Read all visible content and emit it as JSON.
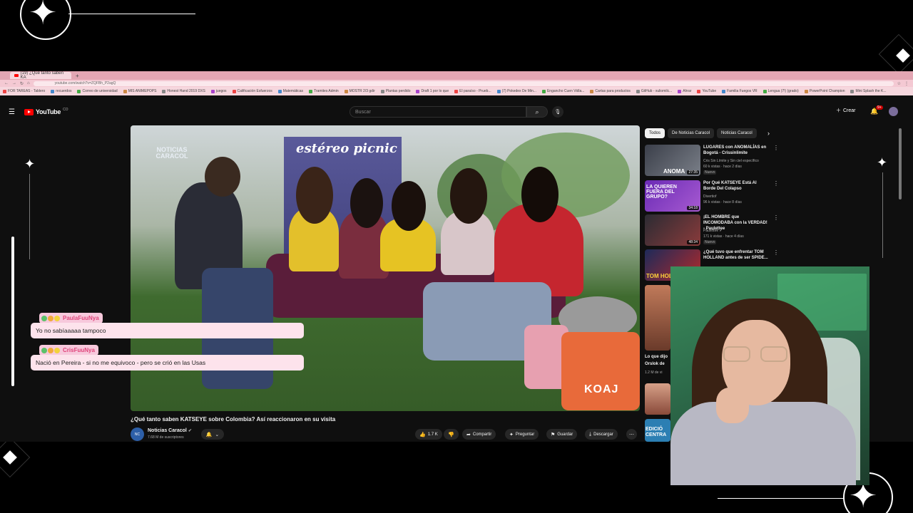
{
  "browser": {
    "tab_title": "(19) ¿Qué tanto saben KA",
    "url": "youtube.com/watch?v=ZQFBh_P2agQ",
    "bookmarks": [
      "FOR TAREAS - Tablero",
      "recuerdos",
      "Correo de universidad",
      "MIS ANIMEPOPS",
      "Honest Hand 2019 DXS",
      "juegos",
      "Calificación Esfuerzos",
      "Matemáticas",
      "Tramites Admin",
      "MOSTR 2/3 gdir",
      "Plantas perdido",
      "Draft 1 por lo que",
      "El paraíso - Prueb...",
      "(7) Pokedex De Min...",
      "Engancho Cuen Vidla...",
      "Cartas para productos",
      "GitHub - xuliomilc...",
      "Ahrar",
      "YouTube",
      "Familia Fuegos VR",
      "Lengua (7!) (grado)",
      "PowerPoint Champion",
      "Mini Splash the K..."
    ]
  },
  "youtube": {
    "logo_text": "YouTube",
    "logo_region": "CO",
    "search_placeholder": "Buscar",
    "create_label": "Crear",
    "notification_count": "9+"
  },
  "video": {
    "banner_text": "estéreo picnic",
    "watermark": "NOTICIAS CARACOL",
    "bag_text": "KOAJ",
    "title": "¿Qué tanto saben KATSEYE sobre Colombia? Así reaccionaron en su visita",
    "channel_name": "Noticias Caracol",
    "channel_avatar_text": "NC",
    "subscribers": "7.68 M de suscriptores",
    "likes": "1.7 K",
    "share_label": "Compartir",
    "ask_label": "Preguntar",
    "save_label": "Guardar",
    "download_label": "Descargar"
  },
  "chips": [
    "Todos",
    "De Noticias Caracol",
    "Noticias Caracol"
  ],
  "recommendations": [
    {
      "title": "LUGARES con ANOMALÍAS en Bogotá - Crissinlimite",
      "channel": "Cris Sin Límite y Sin ciel específico",
      "meta": "60 k vistas · hace 2 días",
      "badge": "Nuevo",
      "duration": "27:35",
      "thumb_text": "ANOMA"
    },
    {
      "title": "Por Qué KATSEYE Está Al Borde Del Colapso",
      "channel": "Divertiof",
      "meta": "96 k vistas · hace 8 días",
      "badge": "",
      "duration": "34:18",
      "thumb_text": "LA QUIEREN FUERA DEL GRUPO?"
    },
    {
      "title": "¡EL HOMBRE que INCOMODABA con la VERDAD! - Paulettee",
      "channel": "Paulettee",
      "meta": "171 k vistas · hace 4 días",
      "badge": "Nuevo",
      "duration": "48:34",
      "thumb_text": ""
    },
    {
      "title": "¿Qué tuvo que enfrentar TOM HOLLAND antes de ser SPIDE...",
      "channel": "",
      "meta": "",
      "badge": "",
      "duration": "",
      "thumb_text": "TOM HOL"
    }
  ],
  "partial_recs": {
    "fifth_title": "Lo que dijo",
    "fifth_channel": "Orslok de",
    "fifth_meta": "1.2 M de vi",
    "last_thumb_text": "EDICIÓ CENTRA"
  },
  "chat": [
    {
      "username": "PaulaFuuNya",
      "message": "Yo no sabíaaaaa tampoco"
    },
    {
      "username": "CrisFuuNya",
      "message": "Nació en Pereira - si no me equivoco - pero se crió en las Usas"
    }
  ],
  "colors": {
    "overlay_bg": "#000000",
    "tabbar": "#e3a6b3",
    "chat_user_bg": "#f7c9dc",
    "chat_msg_bg": "#fde3ec",
    "chat_username": "#e0457b",
    "yt_bg": "#0f0f0f",
    "yt_red": "#ff0000"
  }
}
